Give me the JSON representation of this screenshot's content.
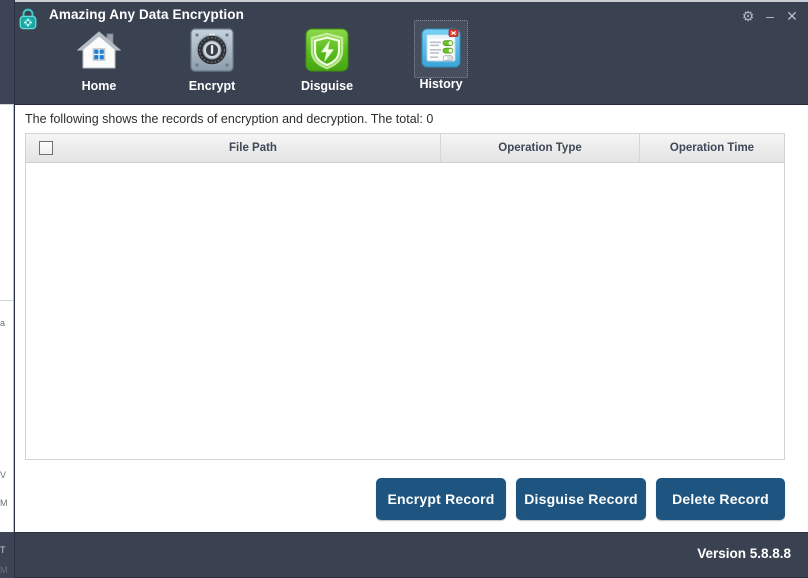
{
  "window": {
    "title": "Amazing Any Data Encryption",
    "app_icon": "padlock-icon",
    "controls": {
      "settings_glyph": "⚙",
      "settings_name": "gear-icon",
      "minimize_glyph": "–",
      "minimize_name": "minimize-icon",
      "close_glyph": "✕",
      "close_name": "close-icon"
    },
    "colors": {
      "header_bg": "#3a4252",
      "footer_bg": "#3a4252",
      "button_blue": "#1d5580",
      "accent_teal": "#18b5b0"
    }
  },
  "toolbar": {
    "items": [
      {
        "label": "Home",
        "icon": "house-icon",
        "selected": false
      },
      {
        "label": "Encrypt",
        "icon": "safe-dial-icon",
        "selected": false
      },
      {
        "label": "Disguise",
        "icon": "green-shield-icon",
        "selected": false
      },
      {
        "label": "History",
        "icon": "history-list-icon",
        "selected": true
      }
    ]
  },
  "content": {
    "info_text": "The following shows the records of encryption and decryption. The total: 0",
    "total_records": 0
  },
  "table": {
    "columns": [
      "",
      "File Path",
      "Operation Type",
      "Operation Time"
    ],
    "header_checkbox_checked": false,
    "rows": []
  },
  "actions": {
    "encrypt_record": "Encrypt Record",
    "disguise_record": "Disguise Record",
    "delete_record": "Delete Record"
  },
  "footer": {
    "version": "Version 5.8.8.8"
  }
}
